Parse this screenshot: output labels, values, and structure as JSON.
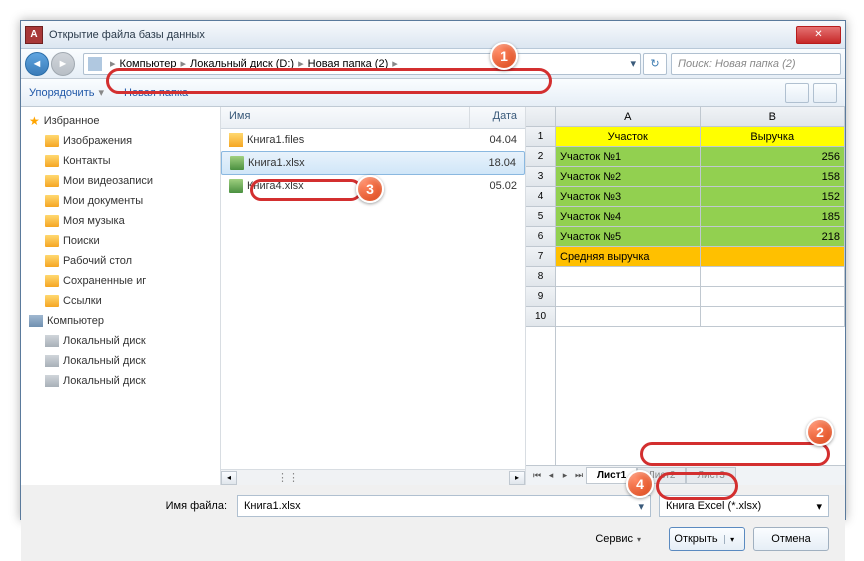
{
  "dialog": {
    "title": "Открытие файла базы данных"
  },
  "breadcrumb": {
    "parts": [
      "Компьютер",
      "Локальный диск (D:)",
      "Новая папка (2)"
    ]
  },
  "search": {
    "placeholder": "Поиск: Новая папка (2)"
  },
  "toolbar": {
    "organize": "Упорядочить",
    "newfolder": "Новая папка"
  },
  "sidebar": {
    "items": [
      {
        "label": "Избранное",
        "kind": "star"
      },
      {
        "label": "Изображения",
        "kind": "folder"
      },
      {
        "label": "Контакты",
        "kind": "folder"
      },
      {
        "label": "Мои видеозаписи",
        "kind": "folder"
      },
      {
        "label": "Мои документы",
        "kind": "folder"
      },
      {
        "label": "Моя музыка",
        "kind": "folder"
      },
      {
        "label": "Поиски",
        "kind": "folder"
      },
      {
        "label": "Рабочий стол",
        "kind": "folder"
      },
      {
        "label": "Сохраненные иг",
        "kind": "folder"
      },
      {
        "label": "Ссылки",
        "kind": "folder"
      },
      {
        "label": "Компьютер",
        "kind": "computer"
      },
      {
        "label": "Локальный диск",
        "kind": "drive"
      },
      {
        "label": "Локальный диск",
        "kind": "drive"
      },
      {
        "label": "Локальный диск",
        "kind": "drive"
      }
    ]
  },
  "filelist": {
    "headers": {
      "name": "Имя",
      "date": "Дата"
    },
    "rows": [
      {
        "name": "Книга1.files",
        "date": "04.04",
        "kind": "folder"
      },
      {
        "name": "Книга1.xlsx",
        "date": "18.04",
        "kind": "xlsx",
        "selected": true
      },
      {
        "name": "Книга4.xlsx",
        "date": "05.02",
        "kind": "xlsx"
      }
    ]
  },
  "preview": {
    "cols": [
      "A",
      "B"
    ],
    "header_row": [
      "Участок",
      "Выручка"
    ],
    "data_rows": [
      [
        "Участок №1",
        "256"
      ],
      [
        "Участок №2",
        "158"
      ],
      [
        "Участок №3",
        "152"
      ],
      [
        "Участок №4",
        "185"
      ],
      [
        "Участок №5",
        "218"
      ]
    ],
    "summary_row": [
      "Средняя выручка",
      ""
    ],
    "blank_rows": 3,
    "tabs": [
      "Лист1",
      "Лист2",
      "Лист3"
    ]
  },
  "bottom": {
    "filename_label": "Имя файла:",
    "filename_value": "Книга1.xlsx",
    "filetype": "Книга Excel (*.xlsx)",
    "service": "Сервис",
    "open": "Открыть",
    "cancel": "Отмена"
  },
  "badges": {
    "b1": "1",
    "b2": "2",
    "b3": "3",
    "b4": "4"
  }
}
